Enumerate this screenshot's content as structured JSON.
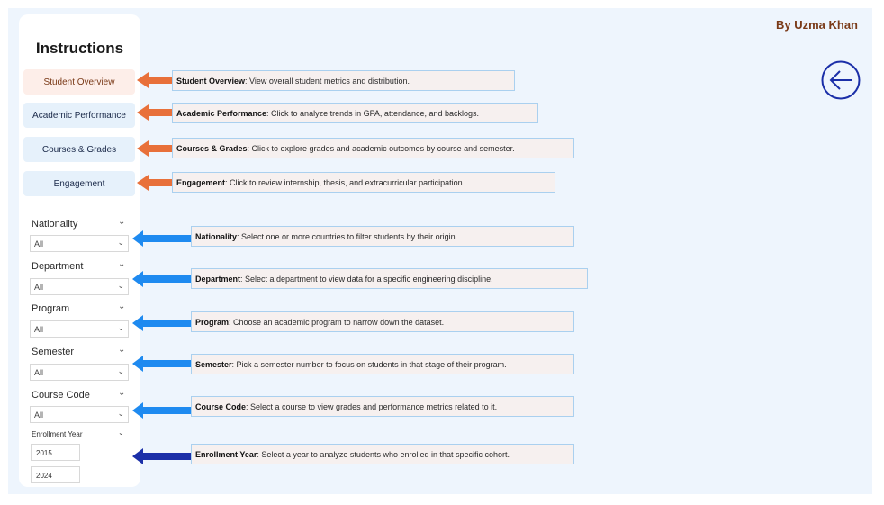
{
  "panel": {
    "title": "Instructions"
  },
  "author": "By Uzma Khan",
  "nav": [
    {
      "label": "Student Overview",
      "active": true
    },
    {
      "label": "Academic Performance",
      "active": false
    },
    {
      "label": "Courses & Grades",
      "active": false
    },
    {
      "label": "Engagement",
      "active": false
    }
  ],
  "slicers": [
    {
      "label": "Nationality",
      "value": "All"
    },
    {
      "label": "Department",
      "value": "All"
    },
    {
      "label": "Program",
      "value": "All"
    },
    {
      "label": "Semester",
      "value": "All"
    },
    {
      "label": "Course Code",
      "value": "All"
    }
  ],
  "enrollment": {
    "label": "Enrollment Year",
    "start": "2015",
    "end": "2024"
  },
  "descriptions": [
    {
      "title": "Student Overview",
      "text": ": View overall student metrics and distribution."
    },
    {
      "title": "Academic Performance",
      "text": ": Click to analyze trends in GPA, attendance, and backlogs."
    },
    {
      "title": "Courses & Grades",
      "text": ": Click to explore grades and academic outcomes by course and semester."
    },
    {
      "title": "Engagement",
      "text": ": Click to review internship, thesis, and extracurricular participation."
    },
    {
      "title": "Nationality",
      "text": ": Select one or more countries to filter students by their origin."
    },
    {
      "title": "Department",
      "text": ": Select a department to view data for a specific engineering discipline."
    },
    {
      "title": "Program",
      "text": ": Choose an academic program to narrow down the dataset."
    },
    {
      "title": "Semester",
      "text": ": Pick a semester number to focus on students in that stage of their program."
    },
    {
      "title": "Course Code",
      "text": ": Select a course to view grades and performance metrics related to it."
    },
    {
      "title": "Enrollment Year",
      "text": ": Select a year to analyze students who enrolled in that specific cohort."
    }
  ],
  "colors": {
    "nav_arrow": "#e8703a",
    "slicer_arrow": "#1e8af0",
    "year_arrow": "#1b2fa8",
    "back_button": "#1b2fa8"
  },
  "icons": {
    "back": "arrow-left-circle-icon",
    "chevron": "chevron-down-icon"
  }
}
